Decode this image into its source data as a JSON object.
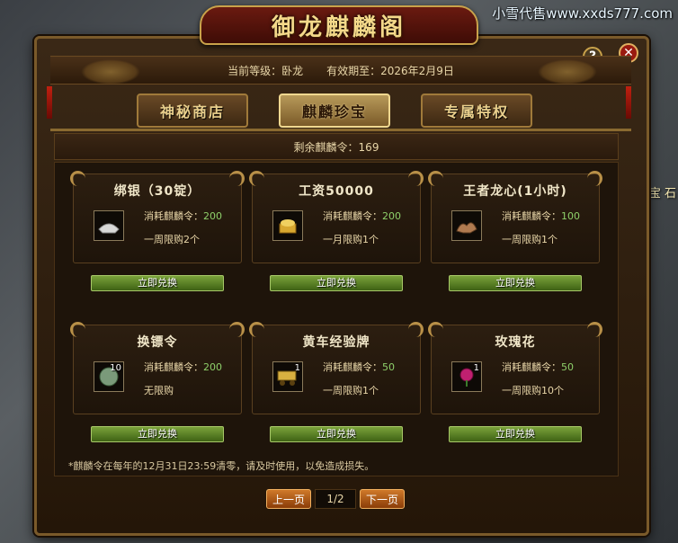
{
  "watermark": "小雪代售www.xxds777.com",
  "background_side_text": "宝 石",
  "window": {
    "title": "御龙麒麟阁",
    "help_label": "?",
    "close_label": "✕"
  },
  "info": {
    "level": "当前等级：卧龙",
    "expiry": "有效期至：2026年2月9日"
  },
  "tabs": [
    {
      "label": "神秘商店",
      "active": false
    },
    {
      "label": "麒麟珍宝",
      "active": true
    },
    {
      "label": "专属特权",
      "active": false
    }
  ],
  "remaining": "剩余麒麟令：169",
  "items": [
    {
      "name": "绑银（30锭）",
      "cost_label": "消耗麒麟令：",
      "cost": "200",
      "limit": "一周限购2个",
      "count": "",
      "icon": "silver-ingot-icon",
      "button": "立即兑换"
    },
    {
      "name": "工资50000",
      "cost_label": "消耗麒麟令：",
      "cost": "200",
      "limit": "一月限购1个",
      "count": "",
      "icon": "gold-treasure-icon",
      "button": "立即兑换"
    },
    {
      "name": "王者龙心(1小时)",
      "cost_label": "消耗麒麟令：",
      "cost": "100",
      "limit": "一周限购1个",
      "count": "",
      "icon": "dragon-heart-icon",
      "button": "立即兑换"
    },
    {
      "name": "换镖令",
      "cost_label": "消耗麒麟令：",
      "cost": "200",
      "limit": "无限购",
      "count": "10",
      "icon": "escort-token-icon",
      "button": "立即兑换"
    },
    {
      "name": "黄车经验牌",
      "cost_label": "消耗麒麟令：",
      "cost": "50",
      "limit": "一周限购1个",
      "count": "1",
      "icon": "gold-cart-icon",
      "button": "立即兑换"
    },
    {
      "name": "玫瑰花",
      "cost_label": "消耗麒麟令：",
      "cost": "50",
      "limit": "一周限购10个",
      "count": "1",
      "icon": "rose-icon",
      "button": "立即兑换"
    }
  ],
  "note": "*麒麟令在每年的12月31日23:59清零，请及时使用，以免造成损失。",
  "pager": {
    "prev": "上一页",
    "page": "1/2",
    "next": "下一页"
  },
  "colors": {
    "accent_gold": "#c9a24a",
    "cost_green": "#8ed06a",
    "button_green": "#5a8a24",
    "pager_orange": "#c06a1e"
  }
}
